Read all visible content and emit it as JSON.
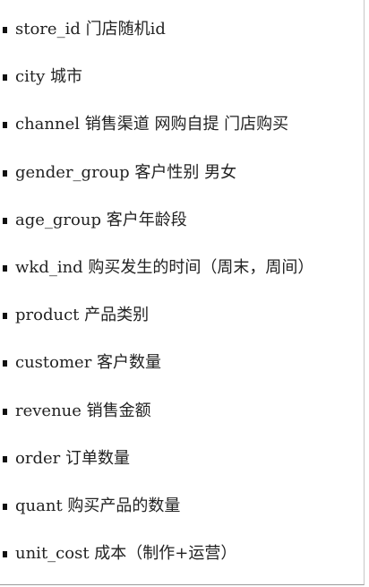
{
  "fields": [
    {
      "label": "store_id 门店随机id"
    },
    {
      "label": "city 城市"
    },
    {
      "label": "channel 销售渠道 网购自提 门店购买"
    },
    {
      "label": "gender_group 客户性别 男女"
    },
    {
      "label": "age_group 客户年龄段"
    },
    {
      "label": "wkd_ind 购买发生的时间（周末，周间）"
    },
    {
      "label": "product 产品类别"
    },
    {
      "label": "customer 客户数量"
    },
    {
      "label": "revenue 销售金额"
    },
    {
      "label": "order 订单数量"
    },
    {
      "label": "quant 购买产品的数量"
    },
    {
      "label": "unit_cost 成本（制作+运营）"
    }
  ]
}
